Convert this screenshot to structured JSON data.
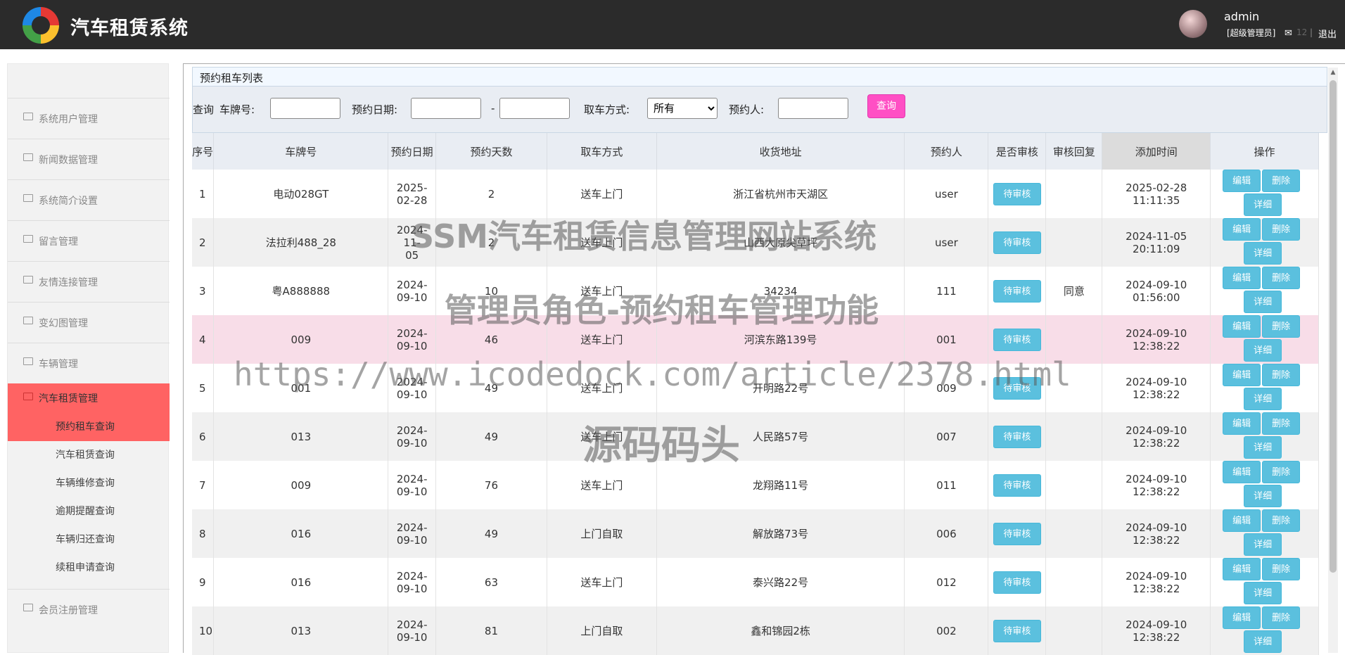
{
  "header": {
    "title": "汽车租赁系统",
    "user": "admin",
    "role": "[超级管理员]",
    "message_count": "12",
    "separator": "|",
    "logout": "退出"
  },
  "sidebar": {
    "items": [
      {
        "label": "系统用户管理"
      },
      {
        "label": "新闻数据管理"
      },
      {
        "label": "系统简介设置"
      },
      {
        "label": "留言管理"
      },
      {
        "label": "友情连接管理"
      },
      {
        "label": "变幻图管理"
      },
      {
        "label": "车辆管理"
      },
      {
        "label": "汽车租赁管理"
      },
      {
        "label": "会员注册管理"
      }
    ],
    "sub_items": [
      {
        "label": "预约租车查询"
      },
      {
        "label": "汽车租赁查询"
      },
      {
        "label": "车辆维修查询"
      },
      {
        "label": "逾期提醒查询"
      },
      {
        "label": "车辆归还查询"
      },
      {
        "label": "续租申请查询"
      }
    ]
  },
  "panel": {
    "title": "预约租车列表",
    "search": {
      "prefix": "查询",
      "plate_label": "车牌号:",
      "plate_value": "",
      "date_label": "预约日期:",
      "date_from": "",
      "dash": "-",
      "date_to": "",
      "pickup_label": "取车方式:",
      "pickup_value": "所有",
      "person_label": "预约人:",
      "person_value": "",
      "button": "查询"
    }
  },
  "table": {
    "headers": [
      "序号",
      "车牌号",
      "预约日期",
      "预约天数",
      "取车方式",
      "收货地址",
      "预约人",
      "是否审核",
      "审核回复",
      "添加时间",
      "操作"
    ],
    "status_label": "待审核",
    "edit_label": "编辑",
    "delete_label": "删除",
    "detail_label": "详细",
    "rows": [
      {
        "idx": "1",
        "plate": "电动028GT",
        "date1": "2025-",
        "date2": "02-28",
        "days": "2",
        "pickup": "送车上门",
        "address": "浙江省杭州市天湖区",
        "person": "user",
        "reply": "",
        "time": "2025-02-28 11:11:35"
      },
      {
        "idx": "2",
        "plate": "法拉利488_28",
        "date1": "2024-11-",
        "date2": "05",
        "days": "2",
        "pickup": "送车上门",
        "address": "山西大原尖草坪",
        "person": "user",
        "reply": "",
        "time": "2024-11-05 20:11:09"
      },
      {
        "idx": "3",
        "plate": "粤A888888",
        "date1": "2024-",
        "date2": "09-10",
        "days": "10",
        "pickup": "送车上门",
        "address": "34234",
        "person": "111",
        "reply": "同意",
        "time": "2024-09-10 01:56:00"
      },
      {
        "idx": "4",
        "plate": "009",
        "date1": "2024-",
        "date2": "09-10",
        "days": "46",
        "pickup": "送车上门",
        "address": "河滨东路139号",
        "person": "001",
        "reply": "",
        "time": "2024-09-10 12:38:22"
      },
      {
        "idx": "5",
        "plate": "001",
        "date1": "2024-",
        "date2": "09-10",
        "days": "49",
        "pickup": "送车上门",
        "address": "开明路22号",
        "person": "009",
        "reply": "",
        "time": "2024-09-10 12:38:22"
      },
      {
        "idx": "6",
        "plate": "013",
        "date1": "2024-",
        "date2": "09-10",
        "days": "49",
        "pickup": "送车上门",
        "address": "人民路57号",
        "person": "007",
        "reply": "",
        "time": "2024-09-10 12:38:22"
      },
      {
        "idx": "7",
        "plate": "009",
        "date1": "2024-",
        "date2": "09-10",
        "days": "76",
        "pickup": "送车上门",
        "address": "龙翔路11号",
        "person": "011",
        "reply": "",
        "time": "2024-09-10 12:38:22"
      },
      {
        "idx": "8",
        "plate": "016",
        "date1": "2024-",
        "date2": "09-10",
        "days": "49",
        "pickup": "上门自取",
        "address": "解放路73号",
        "person": "006",
        "reply": "",
        "time": "2024-09-10 12:38:22"
      },
      {
        "idx": "9",
        "plate": "016",
        "date1": "2024-",
        "date2": "09-10",
        "days": "63",
        "pickup": "送车上门",
        "address": "泰兴路22号",
        "person": "012",
        "reply": "",
        "time": "2024-09-10 12:38:22"
      },
      {
        "idx": "10",
        "plate": "013",
        "date1": "2024-",
        "date2": "09-10",
        "days": "81",
        "pickup": "上门自取",
        "address": "鑫和锦园2栋",
        "person": "002",
        "reply": "",
        "time": "2024-09-10 12:38:22"
      }
    ]
  },
  "watermark": {
    "line1": "SSM汽车租赁信息管理网站系统",
    "line2": "管理员角色-预约租车管理功能",
    "line3": "https://www.icodedock.com/article/2378.html",
    "line4": "源码码头"
  },
  "colors": {
    "header": "#2b2b2b",
    "active": "#ff6363",
    "badge": "#5bc0de",
    "query": "#ff4fc4",
    "highlight_row": "#f8dde8"
  }
}
